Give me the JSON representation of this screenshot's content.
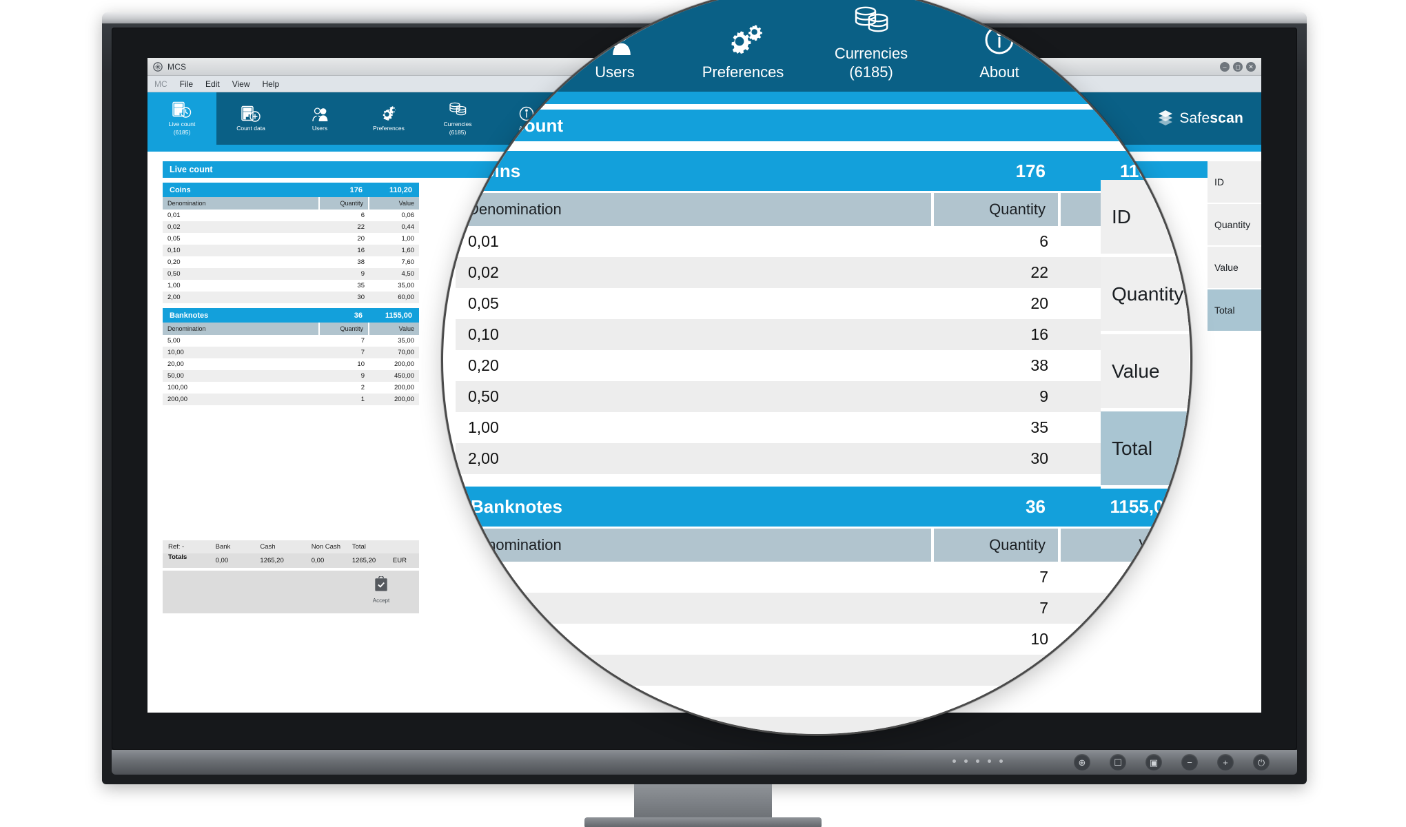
{
  "window": {
    "title": "MCS",
    "controls": [
      "minimize",
      "maximize",
      "close"
    ],
    "menu_app": "MC",
    "menu_items": [
      "File",
      "Edit",
      "View",
      "Help"
    ]
  },
  "nav": {
    "items": [
      {
        "label_line1": "Live count",
        "label_line2": "(6185)",
        "icon": "live-count-icon",
        "active": true
      },
      {
        "label_line1": "Count data",
        "label_line2": "",
        "icon": "count-data-icon",
        "active": false
      },
      {
        "label_line1": "Users",
        "label_line2": "",
        "icon": "users-icon",
        "active": false
      },
      {
        "label_line1": "Preferences",
        "label_line2": "",
        "icon": "preferences-gears-icon",
        "active": false
      },
      {
        "label_line1": "Currencies",
        "label_line2": "(6185)",
        "icon": "currencies-coins-icon",
        "active": false
      },
      {
        "label_line1": "About",
        "label_line2": "",
        "icon": "about-info-icon",
        "active": false
      }
    ],
    "brand_light": "Safe",
    "brand_bold": "scan"
  },
  "page": {
    "title": "Live count"
  },
  "coins": {
    "section_label": "Coins",
    "total_quantity": "176",
    "total_value": "110,20",
    "columns": {
      "denomination": "Denomination",
      "quantity": "Quantity",
      "value": "Value"
    },
    "rows": [
      {
        "denomination": "0,01",
        "quantity": "6",
        "value": "0,06"
      },
      {
        "denomination": "0,02",
        "quantity": "22",
        "value": "0,44"
      },
      {
        "denomination": "0,05",
        "quantity": "20",
        "value": "1,00"
      },
      {
        "denomination": "0,10",
        "quantity": "16",
        "value": "1,60"
      },
      {
        "denomination": "0,20",
        "quantity": "38",
        "value": "7,60"
      },
      {
        "denomination": "0,50",
        "quantity": "9",
        "value": "4,50"
      },
      {
        "denomination": "1,00",
        "quantity": "35",
        "value": "35,00"
      },
      {
        "denomination": "2,00",
        "quantity": "30",
        "value": "60,00"
      }
    ]
  },
  "banknotes": {
    "section_label": "Banknotes",
    "total_quantity": "36",
    "total_value": "1155,00",
    "columns": {
      "denomination": "Denomination",
      "quantity": "Quantity",
      "value": "Value"
    },
    "rows": [
      {
        "denomination": "5,00",
        "quantity": "7",
        "value": "35,00"
      },
      {
        "denomination": "10,00",
        "quantity": "7",
        "value": "70,00"
      },
      {
        "denomination": "20,00",
        "quantity": "10",
        "value": "200,00"
      },
      {
        "denomination": "50,00",
        "quantity": "9",
        "value": "450,00"
      },
      {
        "denomination": "100,00",
        "quantity": "2",
        "value": "200,00"
      },
      {
        "denomination": "200,00",
        "quantity": "1",
        "value": "200,00"
      }
    ]
  },
  "totals": {
    "ref_label": "Ref: -",
    "row_label": "Totals",
    "columns": [
      "Bank",
      "Cash",
      "Non Cash",
      "Total"
    ],
    "values": {
      "bank": "0,00",
      "cash": "1265,20",
      "non_cash": "0,00",
      "total": "1265,20"
    },
    "currency": "EUR"
  },
  "accept": {
    "label": "Accept",
    "icon": "clipboard-check-icon"
  },
  "right_column": {
    "cells": [
      {
        "label": "ID",
        "selected": false
      },
      {
        "label": "Quantity",
        "selected": false
      },
      {
        "label": "Value",
        "selected": false
      },
      {
        "label": "Total",
        "selected": true
      }
    ]
  },
  "colors": {
    "brand_blue": "#13a0db",
    "nav_dark_blue": "#0a6086",
    "col_header_grey": "#b1c4ce",
    "row_alt_grey": "#eeeeee",
    "selected_cell": "#a9c5d2"
  },
  "monitor": {
    "chin_buttons": [
      "input-icon",
      "menu-icon",
      "display-icon",
      "minus-icon",
      "plus-icon",
      "power-icon"
    ]
  }
}
